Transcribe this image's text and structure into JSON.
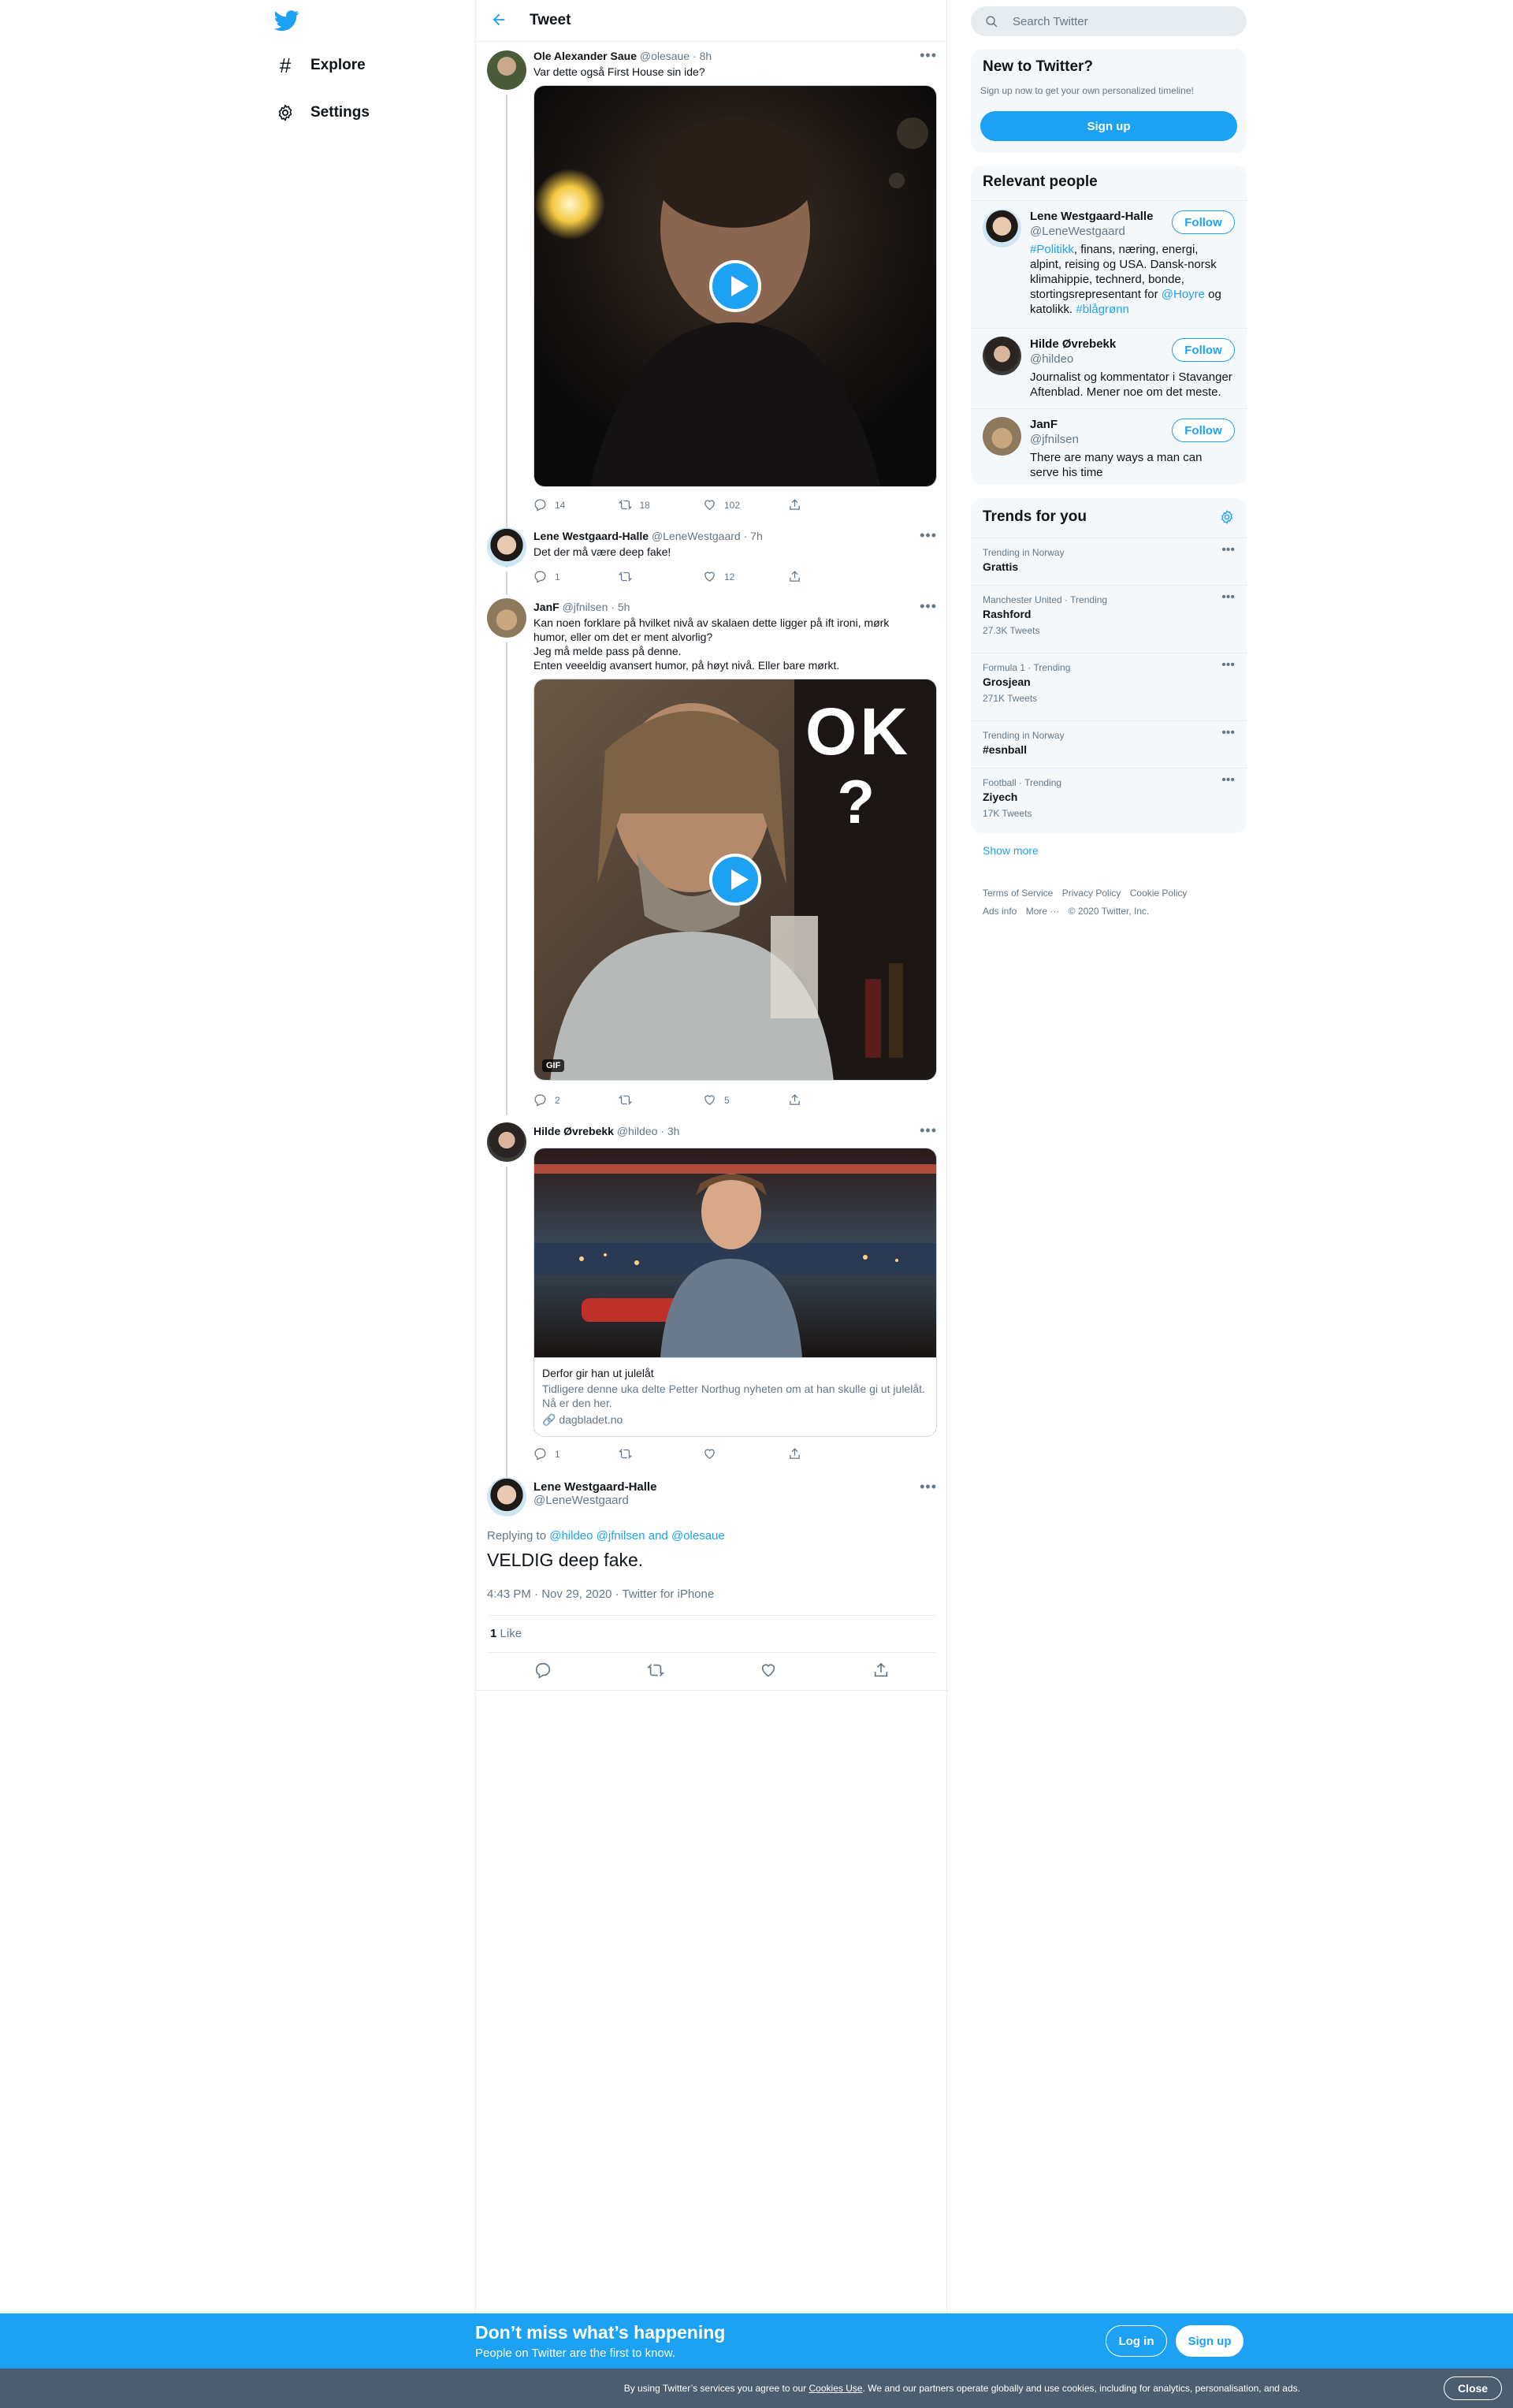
{
  "nav": {
    "explore_label": "Explore",
    "settings_label": "Settings"
  },
  "header": {
    "title": "Tweet"
  },
  "tweets": [
    {
      "name": "Ole Alexander Saue",
      "handle": "@olesaue",
      "time": "· 8h",
      "text": "Var dette også First House sin ide?",
      "replies": "14",
      "retweets": "18",
      "likes": "102"
    },
    {
      "name": "Lene Westgaard-Halle",
      "handle": "@LeneWestgaard",
      "time": "· 7h",
      "text": "Det der må være deep fake!",
      "replies": "1",
      "retweets": "",
      "likes": "12"
    },
    {
      "name": "JanF",
      "handle": "@jfnilsen",
      "time": "· 5h",
      "text_lines": [
        "Kan noen forklare på hvilket nivå av skalaen dette ligger på ift ironi, mørk",
        "humor, eller om det er ment alvorlig?",
        "Jeg må melde pass på denne.",
        "Enten veeeldig avansert humor, på høyt nivå. Eller bare mørkt."
      ],
      "gif_badge": "GIF",
      "overlay_ok": "OK",
      "overlay_q": "?",
      "replies": "2",
      "retweets": "",
      "likes": "5"
    },
    {
      "name": "Hilde Øvrebekk",
      "handle": "@hildeo",
      "time": "· 3h",
      "card_title": "Derfor gir han ut julelåt",
      "card_desc": "Tidligere denne uka delte Petter Northug nyheten om at han skulle gi ut julelåt. Nå er den her.",
      "card_domain": "dagbladet.no",
      "replies": "1",
      "retweets": "",
      "likes": ""
    }
  ],
  "main_tweet": {
    "name": "Lene Westgaard-Halle",
    "handle": "@LeneWestgaard",
    "replying_prefix": "Replying to",
    "replying_1": "@hildeo",
    "replying_2": "@jfnilsen",
    "replying_and": "and",
    "replying_3": "@olesaue",
    "text": "VELDIG deep fake.",
    "meta": "4:43 PM · Nov 29, 2020 · Twitter for iPhone",
    "like_count": "1",
    "like_label": "Like"
  },
  "search": {
    "placeholder": "Search Twitter"
  },
  "new_to_twitter": {
    "title": "New to Twitter?",
    "subtitle": "Sign up now to get your own personalized timeline!",
    "button": "Sign up"
  },
  "relevant_people": {
    "title": "Relevant people",
    "follow_label": "Follow",
    "people": [
      {
        "name": "Lene Westgaard-Halle",
        "handle": "@LeneWestgaard",
        "bio_tag1": "#Politikk",
        "bio_mid": ", finans, næring, energi, alpint, reising og USA. Dansk-norsk klimahippie, technerd, bonde, stortingsrepresentant for ",
        "bio_mention": "@Hoyre",
        "bio_mid2": " og katolikk. ",
        "bio_tag2": "#blågrønn"
      },
      {
        "name": "Hilde Øvrebekk",
        "handle": "@hildeo",
        "bio": "Journalist og kommentator i Stavanger Aftenblad. Mener noe om det meste."
      },
      {
        "name": "JanF",
        "handle": "@jfnilsen",
        "bio": "There are many ways a man can serve his time"
      }
    ]
  },
  "trends": {
    "title": "Trends for you",
    "items": [
      {
        "context": "Trending in Norway",
        "name": "Grattis",
        "count": ""
      },
      {
        "context": "Manchester United · Trending",
        "name": "Rashford",
        "count": "27.3K Tweets"
      },
      {
        "context": "Formula 1 · Trending",
        "name": "Grosjean",
        "count": "271K Tweets"
      },
      {
        "context": "Trending in Norway",
        "name": "#esnball",
        "count": ""
      },
      {
        "context": "Football · Trending",
        "name": "Ziyech",
        "count": "17K Tweets"
      }
    ],
    "show_more": "Show more"
  },
  "footer": {
    "terms": "Terms of Service",
    "privacy": "Privacy Policy",
    "cookie": "Cookie Policy",
    "ads": "Ads info",
    "more": "More ···",
    "copyright": "© 2020 Twitter, Inc."
  },
  "banner": {
    "title": "Don’t miss what’s happening",
    "subtitle": "People on Twitter are the first to know.",
    "login": "Log in",
    "signup": "Sign up"
  },
  "cookie_bar": {
    "prefix": "By using Twitter’s services you agree to our",
    "link": "Cookies Use",
    "suffix": ". We and our partners operate globally and use cookies, including for analytics, personalisation, and ads.",
    "close": "Close"
  },
  "colors": {
    "accent": "#1da1f2",
    "text": "#0f1419",
    "muted": "#657786",
    "cookie_bg": "#4b5d6e"
  }
}
